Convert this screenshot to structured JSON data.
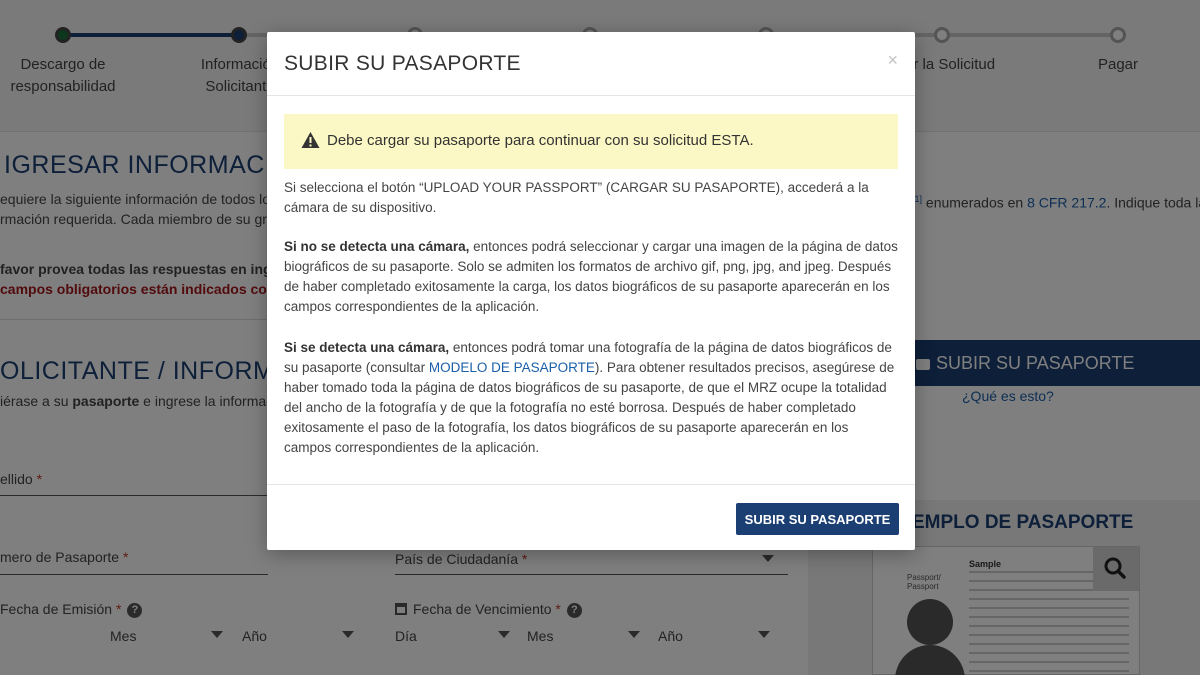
{
  "stepper": {
    "steps": [
      {
        "label": "Descargo de\nresponsabilidad"
      },
      {
        "label": "Información\nSolicitante"
      },
      {
        "label": "ar la Solicitud"
      },
      {
        "label": "Pagar"
      }
    ]
  },
  "page": {
    "section1_title": "IGRESAR INFORMACIÓN",
    "section1_line1_pre": "equiere la siguiente información de todos lo",
    "section1_line1_post_pre": "enumerados en ",
    "section1_line1_link": "8 CFR 217.2",
    "section1_line1_post": ". Indique toda la",
    "section1_line1_ref": "[1]",
    "section1_line2": "rmación requerida. Cada miembro de su gr",
    "english_note": "favor provea todas las respuestas en inglé",
    "required_note": "campos obligatorios están indicados con u",
    "section2_title": "OLICITANTE / INFORMACIÓN",
    "section2_line_pre": "iérase a su ",
    "section2_line_bold": "pasaporte",
    "section2_line_post": " e ingrese la informaci",
    "upload_button": "SUBIR SU PASAPORTE",
    "what_is_this": "¿Qué es esto?",
    "surname_label": "ellido",
    "passport_number_label": "mero de Pasaporte",
    "citizenship_label": "País de Ciudadanía",
    "issue_date_label": "Fecha de Emisión",
    "expiry_date_label": "Fecha de Vencimiento",
    "month_placeholder": "Mes",
    "year_placeholder": "Año",
    "day_placeholder": "Día",
    "required_star": "*",
    "help_glyph": "?",
    "sample_title": "EMPLO DE PASAPORTE",
    "sample_card_heading": "Sample",
    "sample_card_label": "Passport/\nPassport"
  },
  "modal": {
    "title": "SUBIR SU PASAPORTE",
    "close": "×",
    "alert": "Debe cargar su pasaporte para continuar con su solicitud ESTA.",
    "p1": "Si selecciona el botón “UPLOAD YOUR PASSPORT” (CARGAR SU PASAPORTE), accederá a la cámara de su dispositivo.",
    "p2_bold": "Si no se detecta una cámara,",
    "p2_rest": " entonces podrá seleccionar y cargar una imagen de la página de datos biográficos de su pasaporte. Solo se admiten los formatos de archivo gif, png, jpg, and jpeg. Después de haber completado exitosamente la carga, los datos biográficos de su pasaporte aparecerán en los campos correspondientes de la aplicación.",
    "p3_bold": "Si se detecta una cámara,",
    "p3_rest1": " entonces podrá tomar una fotografía de la página de datos biográficos de su pasaporte (consultar ",
    "p3_link": "MODELO DE PASAPORTE",
    "p3_rest2": "). Para obtener resultados precisos, asegúrese de haber tomado toda la página de datos biográficos de su pasaporte, de que el MRZ ocupe la totalidad del ancho de la fotografía y de que la fotografía no esté borrosa. Después de haber completado exitosamente el paso de la fotografía, los datos biográficos de su pasaporte aparecerán en los campos correspondientes de la aplicación.",
    "button": "SUBIR SU PASAPORTE"
  }
}
